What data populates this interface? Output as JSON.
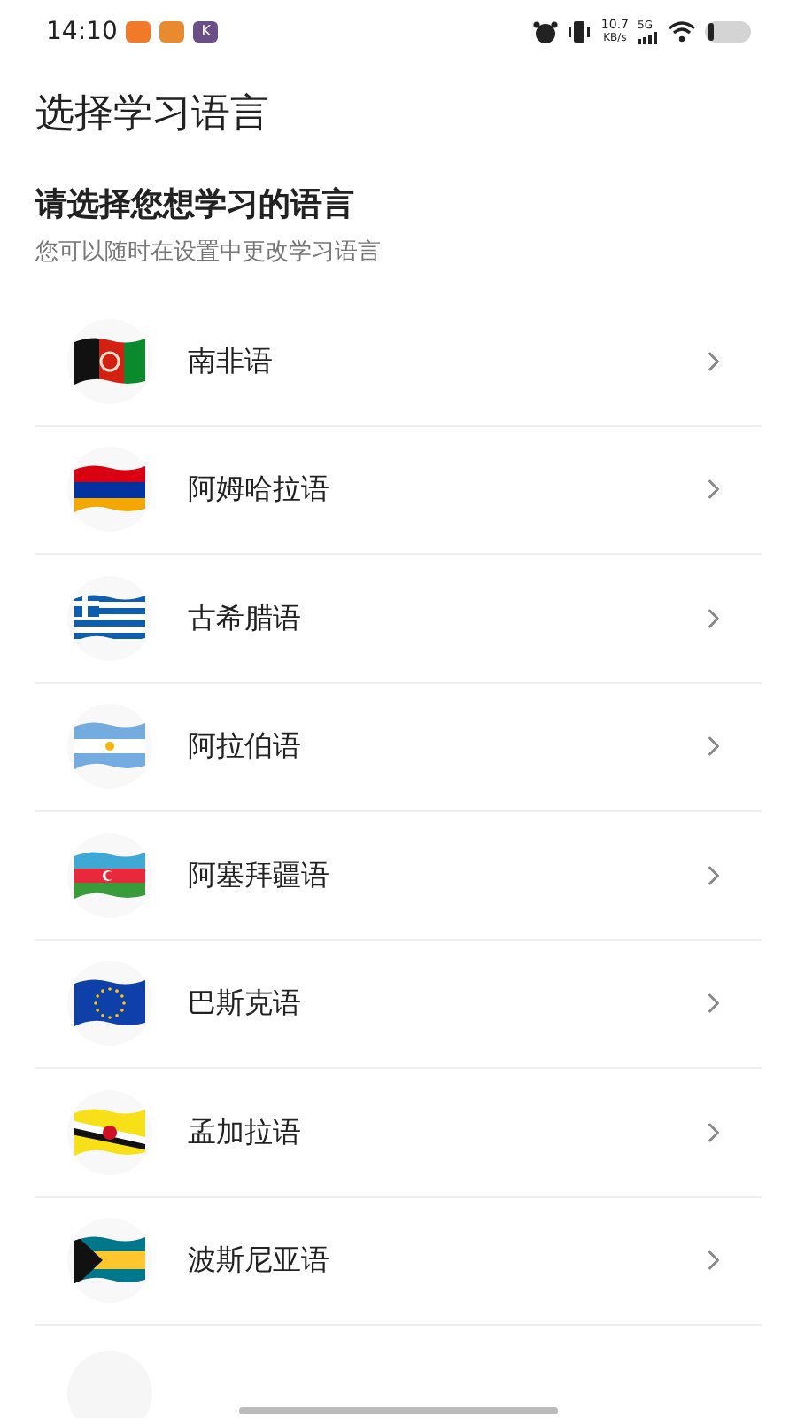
{
  "status_bar": {
    "time": "14:10",
    "app_badge": "K",
    "net_speed": "10.7",
    "net_unit": "KB/s",
    "network": "5G"
  },
  "title": "选择学习语言",
  "heading": "请选择您想学习的语言",
  "subtitle": "您可以随时在设置中更改学习语言",
  "languages": [
    {
      "name": "南非语"
    },
    {
      "name": "阿姆哈拉语"
    },
    {
      "name": "古希腊语"
    },
    {
      "name": "阿拉伯语"
    },
    {
      "name": "阿塞拜疆语"
    },
    {
      "name": "巴斯克语"
    },
    {
      "name": "孟加拉语"
    },
    {
      "name": "波斯尼亚语"
    }
  ]
}
